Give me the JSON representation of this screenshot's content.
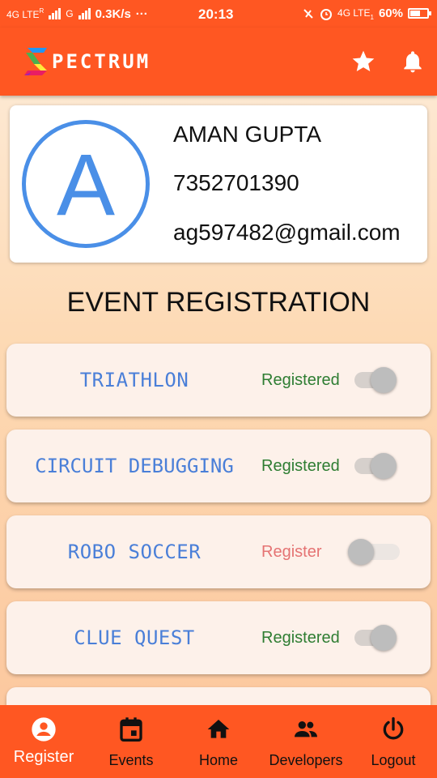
{
  "status_bar": {
    "net1": "4G LTE",
    "net1_sup": "R",
    "net2": "G",
    "speed": "0.3K/s",
    "dots": "···",
    "time": "20:13",
    "net3": "4G LTE",
    "net3_sub": "1",
    "battery": "60%",
    "battery_level": 0.6
  },
  "app_bar": {
    "logo_text": "PECTRUM",
    "star_icon": "star-icon",
    "bell_icon": "bell-icon"
  },
  "profile": {
    "avatar_letter": "A",
    "name": "AMAN GUPTA",
    "phone": "7352701390",
    "email": "ag597482@gmail.com"
  },
  "section_title": "EVENT REGISTRATION",
  "events": [
    {
      "name": "TRIATHLON",
      "status": "Registered",
      "registered": true
    },
    {
      "name": "CIRCUIT DEBUGGING",
      "status": "Registered",
      "registered": true
    },
    {
      "name": "ROBO SOCCER",
      "status": "Register",
      "registered": false
    },
    {
      "name": "CLUE QUEST",
      "status": "Registered",
      "registered": true
    }
  ],
  "nav": [
    {
      "label": "Register",
      "icon": "account-circle-icon",
      "active": true
    },
    {
      "label": "Events",
      "icon": "calendar-icon",
      "active": false
    },
    {
      "label": "Home",
      "icon": "home-icon",
      "active": false
    },
    {
      "label": "Developers",
      "icon": "people-icon",
      "active": false
    },
    {
      "label": "Logout",
      "icon": "power-icon",
      "active": false
    }
  ],
  "colors": {
    "primary": "#ff5722",
    "registered": "#2e7d32",
    "register": "#e57373",
    "event_name": "#4a7fd8",
    "avatar": "#4a8fe7"
  }
}
